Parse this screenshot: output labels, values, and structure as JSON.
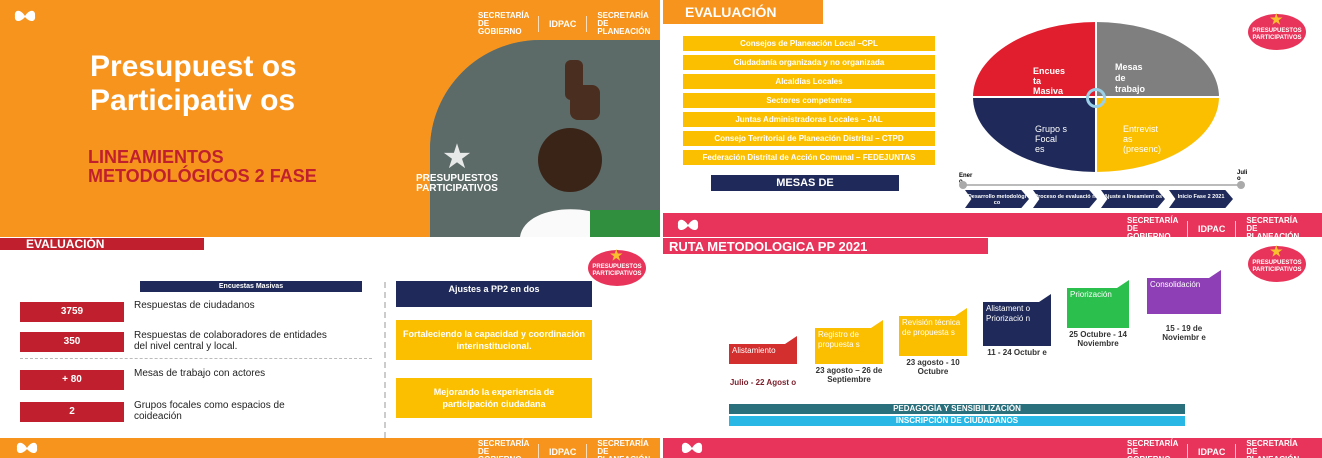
{
  "brand": {
    "logos": [
      "SECRETARÍA DE GOBIERNO",
      "IDPAC",
      "SECRETARÍA DE PLANEACIÓN"
    ],
    "badge": "PRESUPUESTOS PARTICIPATIVOS"
  },
  "slide1": {
    "title": "Presupuest os Participativ os",
    "subtitle": "LINEAMIENTOS METODOLÓGICOS 2 FASE",
    "badge": "PRESUPUESTOS PARTICIPATIVOS"
  },
  "slide2": {
    "title": "EVALUACIÓN",
    "actors": [
      "Consejos de Planeación Local –CPL",
      "Ciudadanía organizada y no organizada",
      "Alcaldías Locales",
      "Sectores competentes",
      "Juntas Administradoras Locales – JAL",
      "Consejo Territorial de Planeación Distrital – CTPD",
      "Federación Distrital de Acción Comunal – FEDEJUNTAS"
    ],
    "mesas_label": "MESAS DE",
    "quadrants": [
      "Encues ta Masiva",
      "Mesas de trabajo",
      "Grupo s Focal es",
      "Entrevist as (presenc)"
    ],
    "timeline_start": "Ener o",
    "timeline_end": "Juli o",
    "steps": [
      "Desarrollo metodológi co",
      "Proceso de evaluació n",
      "Ajuste a lineamient os",
      "Inicio Fase 2 2021"
    ]
  },
  "slide3": {
    "title": "EVALUACIÓN",
    "table_header": "Encuestas Masivas",
    "rows": [
      {
        "value": "3759",
        "label": "Respuestas de ciudadanos"
      },
      {
        "value": "350",
        "label": "Respuestas de colaboradores de entidades del nivel central y local."
      },
      {
        "value": "+ 80",
        "label": "Mesas de trabajo con actores"
      },
      {
        "value": "2",
        "label": "Grupos focales como espacios de coideación"
      }
    ],
    "right_header": "Ajustes a PP2 en dos",
    "adjustments": [
      "Fortaleciendo la capacidad y coordinación interinstitucional.",
      "Mejorando la experiencia de participación ciudadana"
    ]
  },
  "slide4": {
    "title": "RUTA METODOLOGICA PP 2021",
    "phases": [
      {
        "name": "Alistamiento",
        "dates": "Julio - 22 Agost o",
        "color": "#d42f2f"
      },
      {
        "name": "Registro de propuesta s",
        "dates": "23 agosto – 26 de Septiembre",
        "color": "#fbbf00"
      },
      {
        "name": "Revisión técnica de propuesta s",
        "dates": "23 agosto - 10 Octubre",
        "color": "#fbbf00"
      },
      {
        "name": "Alistament o Priorizació n",
        "dates": "11 - 24 Octubr e",
        "color": "#1f2a5a"
      },
      {
        "name": "Priorización",
        "dates": "25 Octubre - 14 Noviembre",
        "color": "#2bbf4e"
      },
      {
        "name": "Consolidación",
        "dates": "15 - 19 de Noviembr e",
        "color": "#8e3fb5"
      }
    ],
    "bars": [
      "PEDAGOGÍA Y SENSIBILIZACIÓN",
      "INSCRIPCIÓN DE CIUDADANOS"
    ]
  },
  "colors": {
    "orange": "#f7941d",
    "red": "#c0202d",
    "yellow": "#fbbf00",
    "navy": "#1f2a5a",
    "pink": "#e8345a",
    "teal": "#2a6f7c",
    "cyan": "#29b8e5"
  }
}
